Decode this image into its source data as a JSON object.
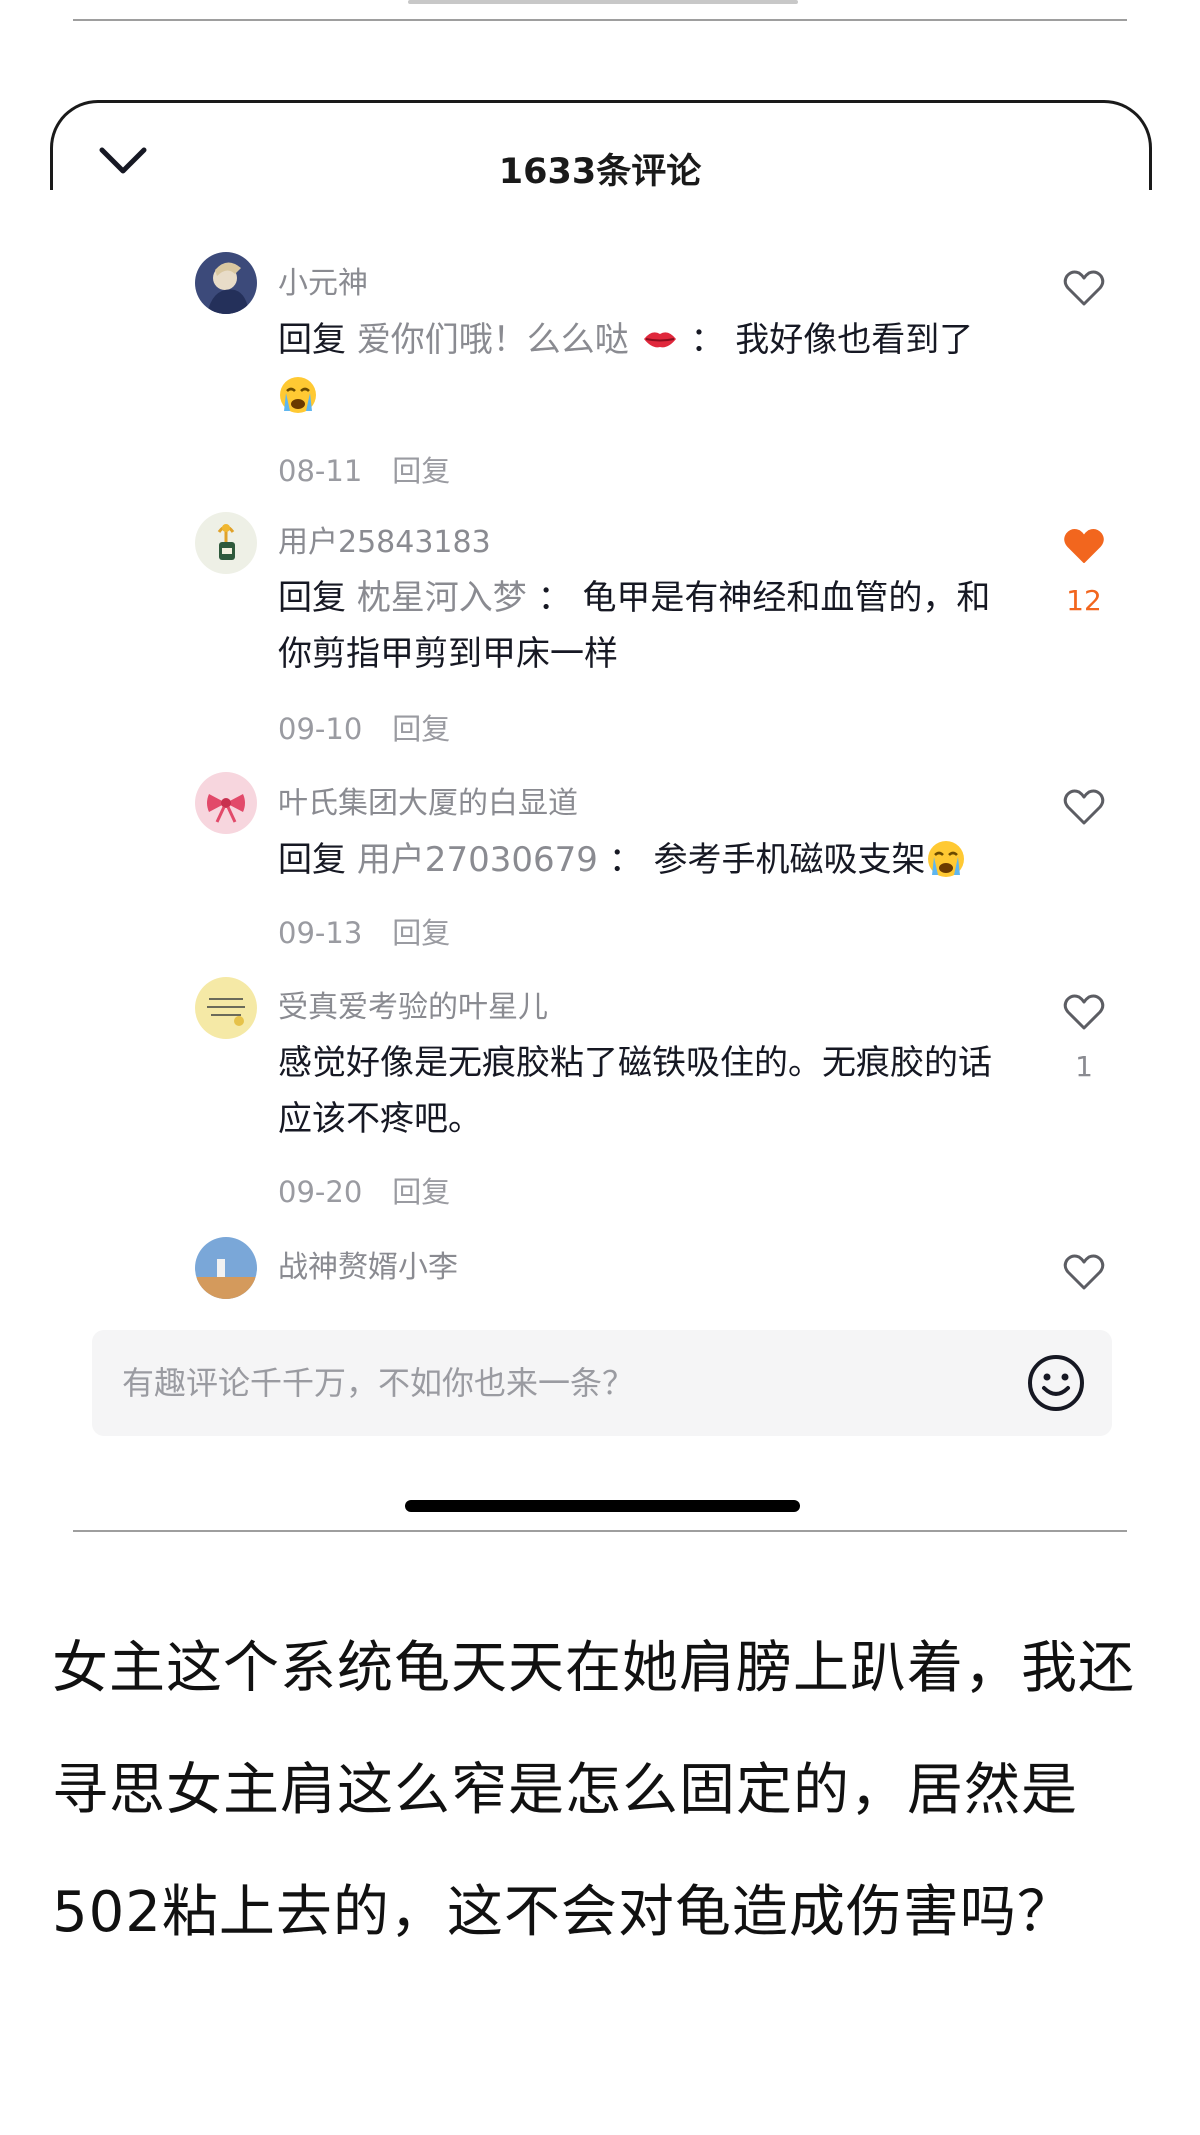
{
  "sheet": {
    "title": "1633条评论",
    "collapse_icon": "chevron-down-icon"
  },
  "comments": [
    {
      "username": "小元神",
      "reply_prefix": "回复",
      "reply_target": "爱你们哦！么么哒",
      "separator": "：",
      "text": "我好像也看到了",
      "emojis": [
        "lips-emoji",
        "crying-emoji"
      ],
      "date": "08-11",
      "reply_label": "回复",
      "liked": false,
      "like_count": ""
    },
    {
      "username": "用户25843183",
      "reply_prefix": "回复",
      "reply_target": "枕星河入梦",
      "separator": "：",
      "text": "龟甲是有神经和血管的，和你剪指甲剪到甲床一样",
      "date": "09-10",
      "reply_label": "回复",
      "liked": true,
      "like_count": "12"
    },
    {
      "username": "叶氏集团大厦的白显道",
      "reply_prefix": "回复",
      "reply_target": "用户27030679",
      "separator": "：",
      "text": "参考手机磁吸支架",
      "emojis": [
        "crying-emoji"
      ],
      "date": "09-13",
      "reply_label": "回复",
      "liked": false,
      "like_count": ""
    },
    {
      "username": "受真爱考验的叶星儿",
      "text": "感觉好像是无痕胶粘了磁铁吸住的。无痕胶的话应该不疼吧。",
      "date": "09-20",
      "reply_label": "回复",
      "liked": false,
      "like_count": "1"
    },
    {
      "username": "战神赘婿小李",
      "liked": false,
      "like_count": ""
    }
  ],
  "input": {
    "placeholder": "有趣评论千千万，不如你也来一条？",
    "emoji_icon": "smiley-icon"
  },
  "caption": {
    "text": "女主这个系统龟天天在她肩膀上趴着，我还寻思女主肩这么窄是怎么固定的，居然是502粘上去的，这不会对龟造成伤害吗？"
  },
  "colors": {
    "liked_heart": "#f2661e",
    "secondary_text": "#8a8b91",
    "input_bg": "#f5f5f6"
  }
}
